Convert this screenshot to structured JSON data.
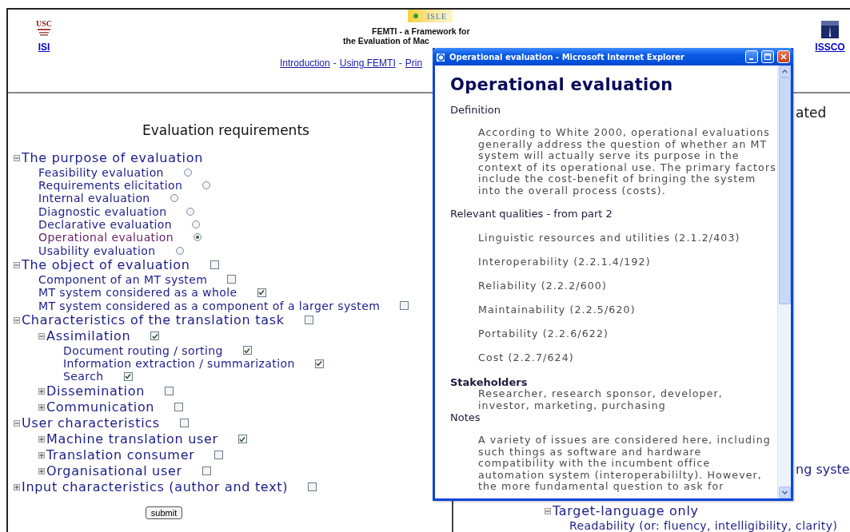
{
  "header": {
    "left_logo": {
      "text": "USC"
    },
    "left_link": "ISI",
    "center_logo": {
      "text": "ISLE"
    },
    "title_lines": [
      "FEMTI - a Framework for",
      "the Evaluation of Mac"
    ],
    "nav": [
      {
        "kind": "link",
        "text": "Introduction"
      },
      {
        "kind": "separator",
        "text": "-"
      },
      {
        "kind": "link",
        "text": "Using FEMTI"
      },
      {
        "kind": "separator",
        "text": "-"
      },
      {
        "kind": "link",
        "text": "Prin"
      }
    ],
    "right_link": "ISSCO"
  },
  "left_panel": {
    "heading": "Evaluation requirements",
    "submit": "submit",
    "tree": [
      {
        "label": "The purpose of evaluation",
        "expanded": true,
        "children": [
          {
            "label": "Feasibility evaluation",
            "kind": "radio",
            "selected": false
          },
          {
            "label": "Requirements elicitation",
            "kind": "radio",
            "selected": false
          },
          {
            "label": "Internal evaluation",
            "kind": "radio",
            "selected": false
          },
          {
            "label": "Diagnostic evaluation",
            "kind": "radio",
            "selected": false
          },
          {
            "label": "Declarative evaluation",
            "kind": "radio",
            "selected": false
          },
          {
            "label": "Operational evaluation",
            "kind": "radio",
            "selected": true
          },
          {
            "label": "Usability evaluation",
            "kind": "radio",
            "selected": false
          }
        ]
      },
      {
        "label": "The object of evaluation",
        "expanded": true,
        "kind": "checkbox",
        "checked": false,
        "children": [
          {
            "label": "Component of an MT system",
            "kind": "checkbox",
            "checked": false
          },
          {
            "label": "MT system considered as a whole",
            "kind": "checkbox",
            "checked": true
          },
          {
            "label": "MT system considered as a component of a larger system",
            "kind": "checkbox",
            "checked": false
          }
        ]
      },
      {
        "label": "Characteristics of the translation task",
        "expanded": true,
        "kind": "checkbox",
        "checked": false,
        "children": [
          {
            "label": "Assimilation",
            "expanded": true,
            "kind": "checkbox",
            "checked": true,
            "children": [
              {
                "label": "Document routing / sorting",
                "kind": "checkbox",
                "checked": true
              },
              {
                "label": "Information extraction / summarization",
                "kind": "checkbox",
                "checked": true
              },
              {
                "label": "Search",
                "kind": "checkbox",
                "checked": true
              }
            ]
          },
          {
            "label": "Dissemination",
            "expanded": false,
            "kind": "checkbox",
            "checked": false
          },
          {
            "label": "Communication",
            "expanded": false,
            "kind": "checkbox",
            "checked": false
          }
        ]
      },
      {
        "label": "User characteristics",
        "expanded": true,
        "kind": "checkbox",
        "checked": false,
        "children": [
          {
            "label": "Machine translation user",
            "expanded": false,
            "kind": "checkbox",
            "checked": true
          },
          {
            "label": "Translation consumer",
            "expanded": false,
            "kind": "checkbox",
            "checked": false
          },
          {
            "label": "Organisational user",
            "expanded": false,
            "kind": "checkbox",
            "checked": false
          }
        ]
      },
      {
        "label": "Input characteristics (author and text)",
        "expanded": false,
        "kind": "checkbox",
        "checked": false
      }
    ]
  },
  "right_panel": {
    "heading_fragment": "ated",
    "fragment": "ng syste",
    "tree": [
      {
        "label": "Target-language only",
        "expanded": true,
        "children": [
          {
            "label": "Readability (or: fluency, intelligibility, clarity)"
          }
        ]
      }
    ]
  },
  "popup": {
    "title": "Operational evaluation - Microsoft Internet Explorer",
    "heading": "Operational evaluation",
    "sections": [
      {
        "kind": "paragraph",
        "heading": "Definition",
        "text": "According to White 2000, operational evaluations generally address the question of whether an MT system will actually serve its purpose in the context of its operational use. The primary factors include the cost-benefit of bringing the system into the overall process (costs)."
      },
      {
        "kind": "list",
        "heading": "Relevant qualities - from part 2",
        "items": [
          "Linguistic resources and utilities (2.1.2/403)",
          "Interoperability (2.2.1.4/192)",
          "Reliability (2.2.2/600)",
          "Maintainability (2.2.5/620)",
          "Portability (2.2.6/622)",
          "Cost (2.2.7/624)"
        ]
      },
      {
        "kind": "compact",
        "heading": "Stakeholders",
        "text": "Researcher, research sponsor, developer, investor, marketing, purchasing"
      },
      {
        "kind": "paragraph",
        "heading": "Notes",
        "text": "A variety of issues are considered here, including such things as software and hardware compatibility with the incumbent office automation system (interoperabililty). However, the more fundamental question to ask for"
      }
    ]
  }
}
